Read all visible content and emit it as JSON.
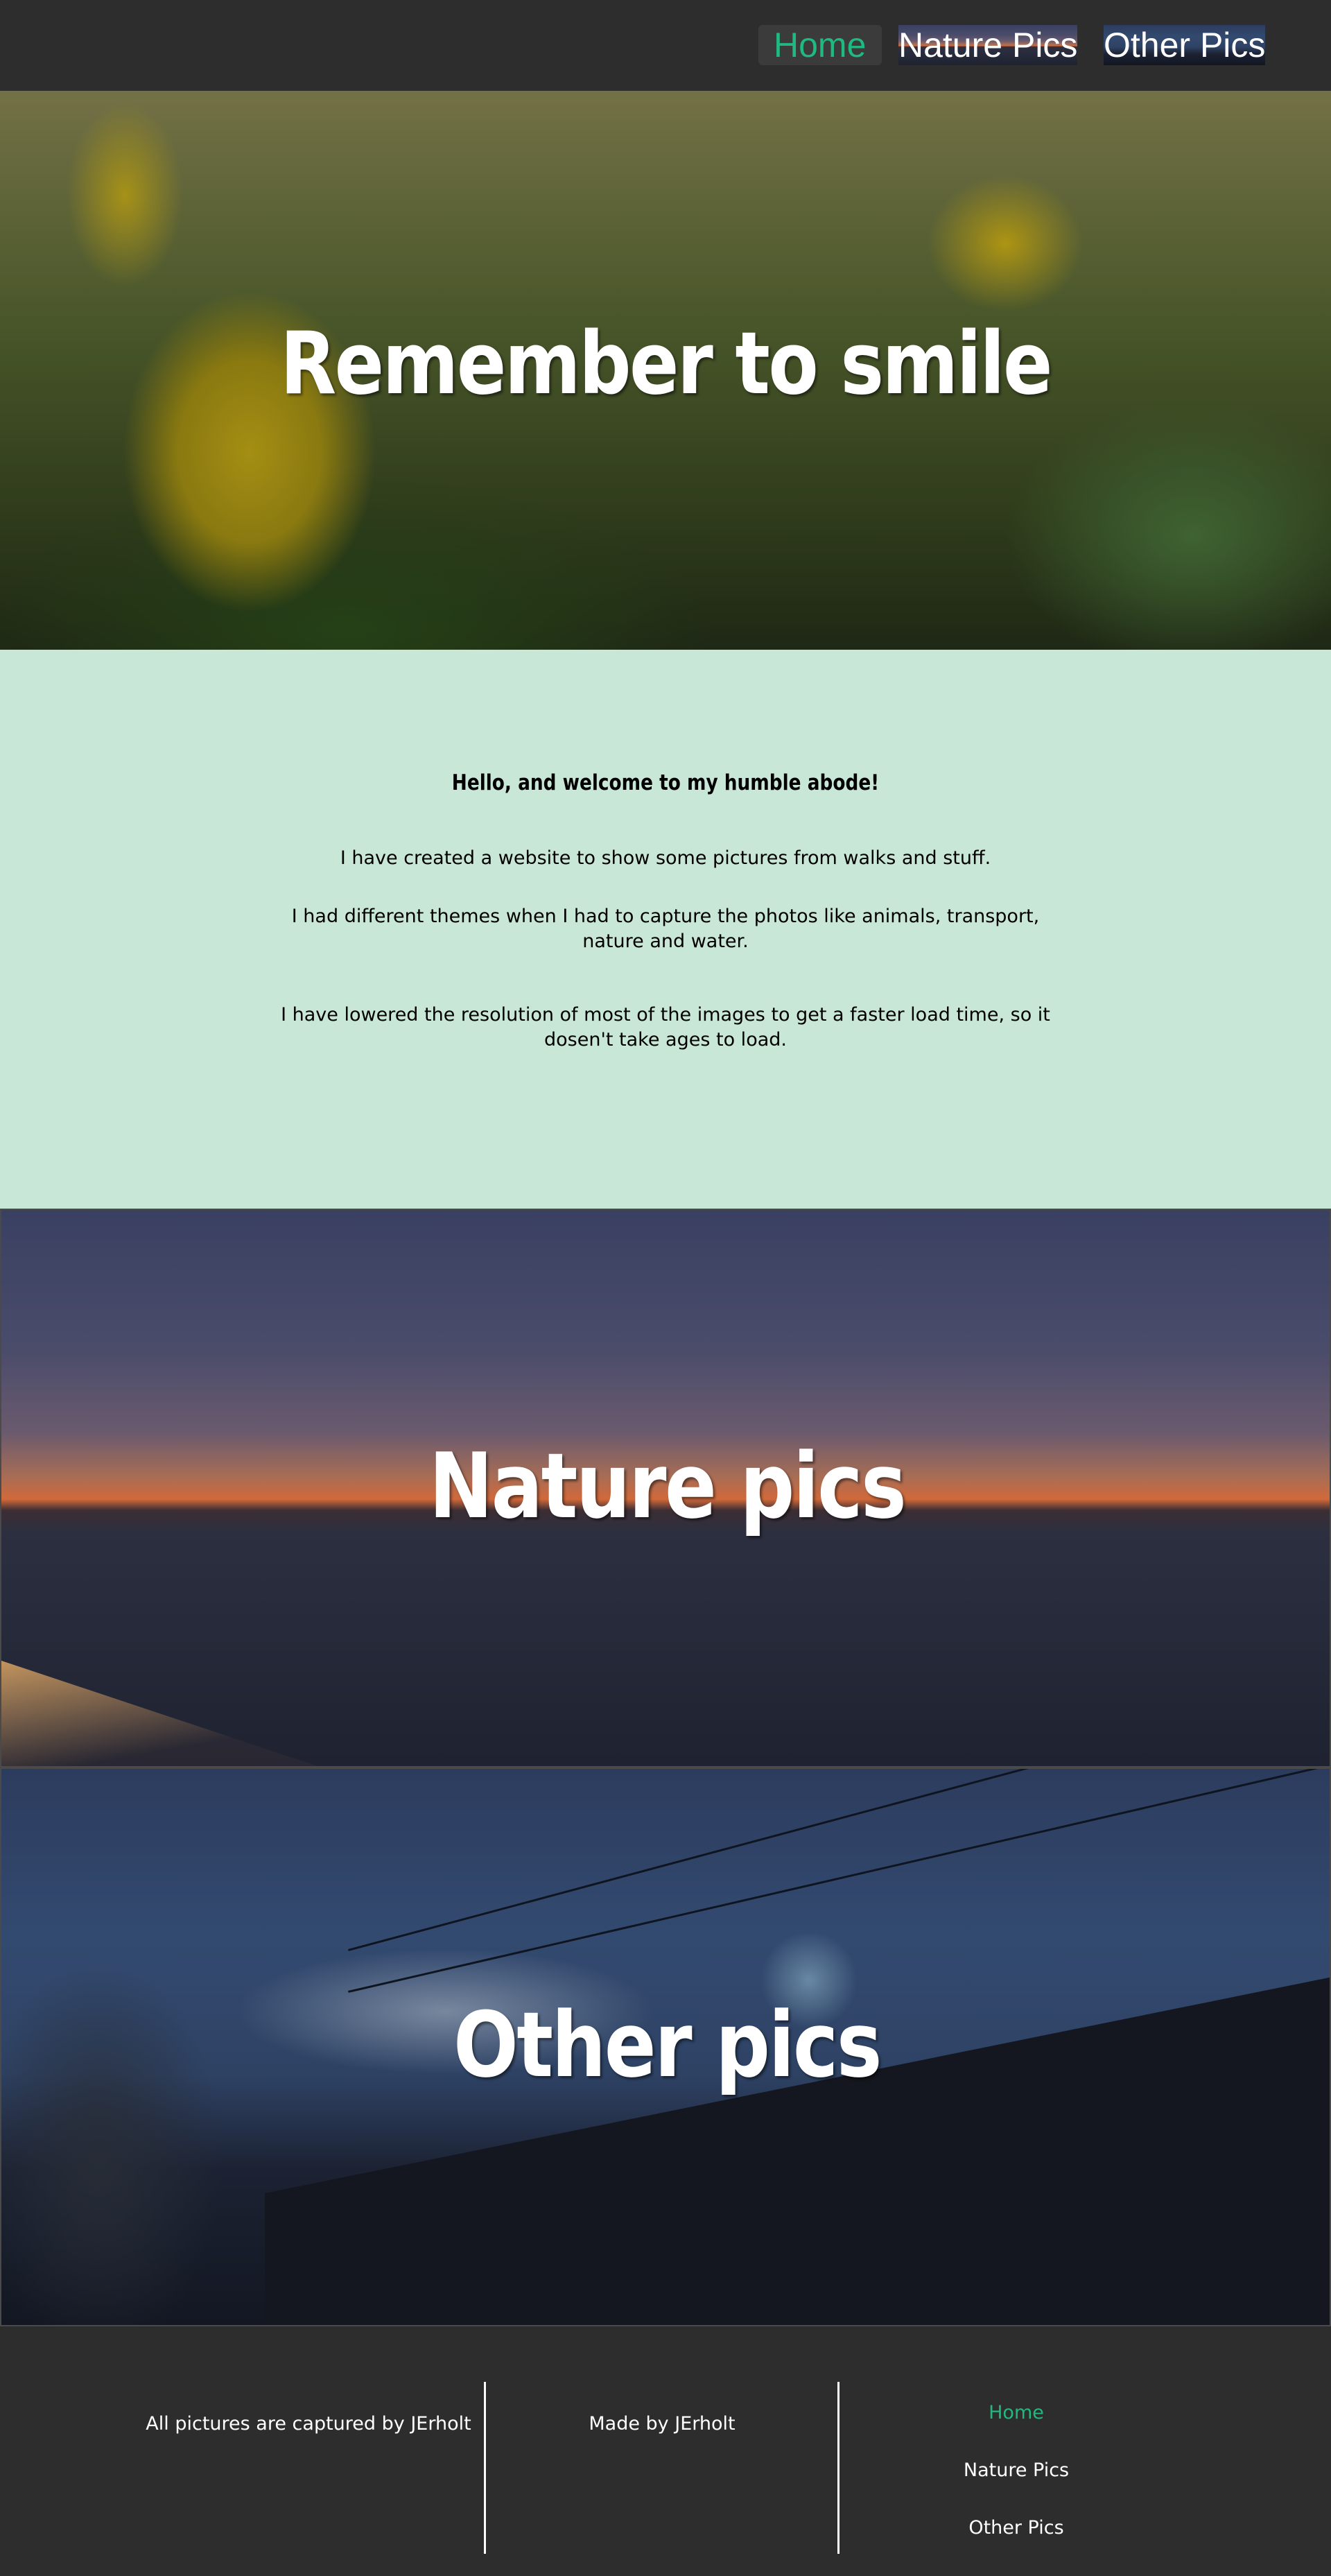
{
  "nav": {
    "items": [
      {
        "label": "Home",
        "active": true
      },
      {
        "label": "Nature Pics",
        "active": false
      },
      {
        "label": "Other Pics",
        "active": false
      }
    ]
  },
  "hero": {
    "title": "Remember to smile"
  },
  "welcome": {
    "heading": "Hello, and welcome to my humble abode!",
    "p1": "I have created a website to show some pictures from walks and stuff.",
    "p2": "I had different themes when I had to capture the photos like animals, transport, nature and water.",
    "p3": "I have lowered the resolution of most of the images to get a faster load time, so it dosen't take ages to load."
  },
  "sections": {
    "nature": {
      "title": "Nature pics"
    },
    "other": {
      "title": "Other pics"
    }
  },
  "footer": {
    "credit": "All pictures are captured by JErholt",
    "made_by": "Made by JErholt",
    "links": [
      {
        "label": "Home",
        "active": true
      },
      {
        "label": "Nature Pics",
        "active": false
      },
      {
        "label": "Other Pics",
        "active": false
      }
    ]
  },
  "colors": {
    "accent": "#1fb981",
    "nav_bg": "#2d2d2d",
    "welcome_bg": "#c9e7d6"
  }
}
